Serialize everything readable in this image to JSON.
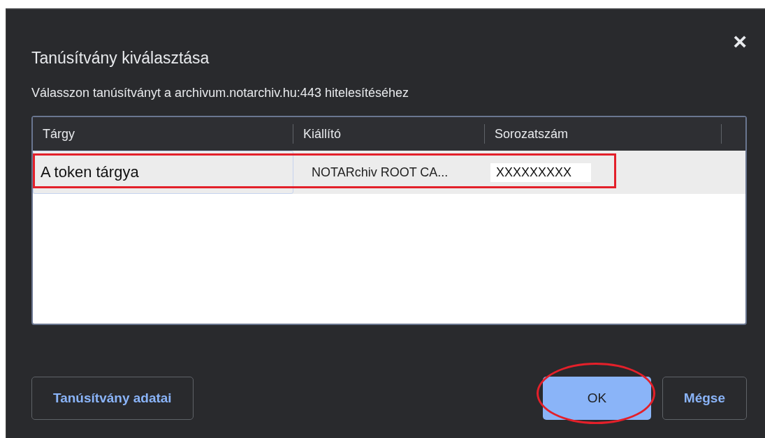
{
  "dialog": {
    "title": "Tanúsítvány kiválasztása",
    "message": "Válasszon tanúsítványt a archivum.notarchiv.hu:443 hitelesítéséhez",
    "close": "×"
  },
  "table": {
    "columns": [
      "Tárgy",
      "Kiállító",
      "Sorozatszám"
    ],
    "rows": [
      {
        "cells": [
          "A token tárgya",
          "NOTARchiv ROOT CA...",
          "XXXXXXXXX"
        ],
        "selected": true
      }
    ]
  },
  "buttons": [
    {
      "label": "Tanúsítvány adatai",
      "kind": "secondary"
    },
    {
      "label": "OK",
      "kind": "primary"
    },
    {
      "label": "Mégse",
      "kind": "secondary"
    }
  ],
  "annotations": [
    {
      "kind": "rectangle"
    },
    {
      "kind": "ellipse"
    }
  ]
}
